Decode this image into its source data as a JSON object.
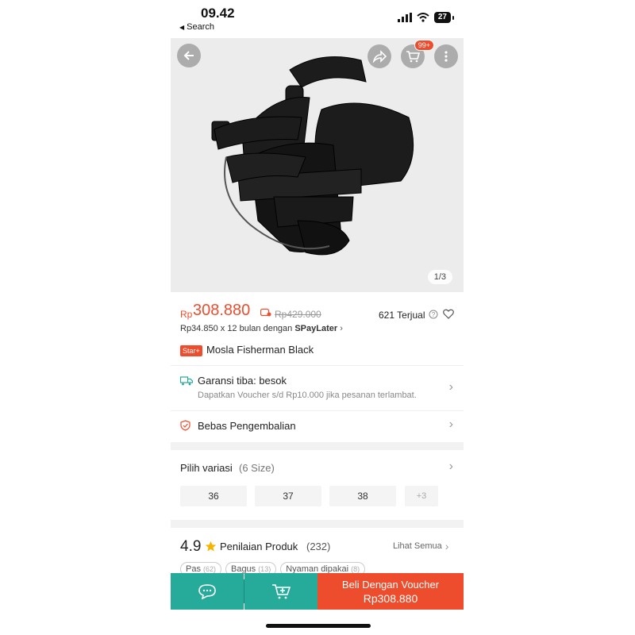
{
  "status_bar": {
    "time": "09.42",
    "back_label": "Search",
    "battery": "27"
  },
  "top_actions": {
    "cart_badge": "99+"
  },
  "gallery": {
    "indicator": "1/3"
  },
  "price": {
    "currency": "Rp",
    "current": "308.880",
    "original": "Rp429.000",
    "sold": "621 Terjual",
    "installment_prefix": "Rp34.850 x 12 bulan dengan ",
    "installment_brand": "SPayLater"
  },
  "product": {
    "badge": "Star+",
    "title": "Mosla Fisherman Black"
  },
  "shipping": {
    "title": "Garansi tiba: besok",
    "subtitle": "Dapatkan Voucher s/d Rp10.000 jika pesanan terlambat."
  },
  "returns": {
    "title": "Bebas Pengembalian"
  },
  "variants": {
    "label": "Pilih variasi",
    "count": "(6 Size)",
    "sizes": [
      "36",
      "37",
      "38"
    ],
    "more": "+3"
  },
  "rating": {
    "score": "4.9",
    "label": "Penilaian Produk",
    "count": "(232)",
    "see_all": "Lihat Semua",
    "tags": [
      {
        "label": "Pas",
        "count": "(62)"
      },
      {
        "label": "Bagus",
        "count": "(13)"
      },
      {
        "label": "Nyaman dipakai",
        "count": "(8)"
      }
    ]
  },
  "bottom_bar": {
    "buy_label": "Beli Dengan Voucher",
    "buy_price": "Rp308.880"
  },
  "colors": {
    "accent": "#ee4d2d",
    "teal": "#26aa99"
  },
  "icons": [
    "back-arrow-icon",
    "share-icon",
    "cart-icon",
    "more-icon",
    "truck-icon",
    "shield-icon",
    "star-icon",
    "chat-icon",
    "add-cart-icon",
    "help-icon",
    "heart-icon"
  ]
}
